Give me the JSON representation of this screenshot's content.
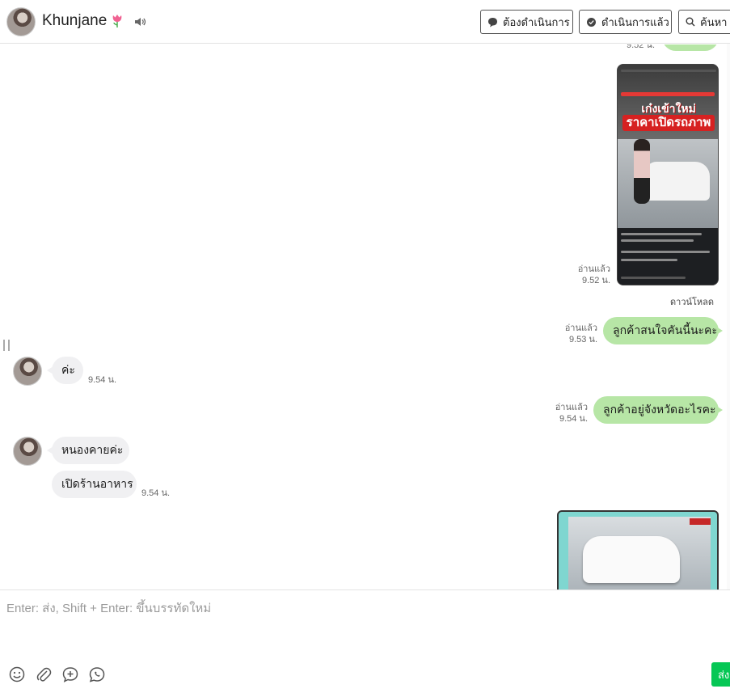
{
  "header": {
    "contact_name": "Khunjane",
    "btn_todo": "ต้องดำเนินการ",
    "btn_done": "ดำเนินการแล้ว",
    "btn_search": "ค้นหา"
  },
  "messages": {
    "top_time": "9.52 น.",
    "image1_read": "อ่านแล้ว",
    "image1_time": "9.52 น.",
    "image1_download": "ดาวน์โหลด",
    "msg1_read": "อ่านแล้ว",
    "msg1_time": "9.53 น.",
    "msg1_text": "ลูกค้าสนใจคันนี้นะคะ",
    "in1_text": "ค่ะ",
    "in1_time": "9.54 น.",
    "msg2_read": "อ่านแล้ว",
    "msg2_time": "9.54 น.",
    "msg2_text": "ลูกค้าอยู่จังหวัดอะไรคะ",
    "in2_text": "หนองคายค่ะ",
    "in3_text": "เปิดร้านอาหาร",
    "in3_time": "9.54 น.",
    "phone_headline1": "เก๋งเข้าใหม่",
    "phone_headline2": "ราคาเปิดรถภาพ"
  },
  "composer": {
    "placeholder": "Enter: ส่ง, Shift + Enter: ขึ้นบรรทัดใหม่",
    "send_label": "ส่ง"
  },
  "colors": {
    "outgoing_bubble": "#b7e6a6",
    "incoming_bubble": "#f0f0f2",
    "send_button": "#06c755"
  }
}
